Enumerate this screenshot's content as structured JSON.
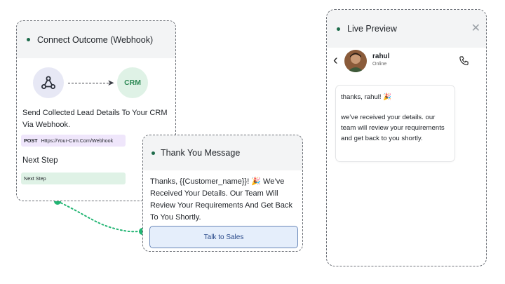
{
  "webhook_card": {
    "title": "Connect Outcome (Webhook)",
    "crm_label": "CRM",
    "description": "Send Collected Lead Details To Your CRM Via Webhook.",
    "post_method": "POST",
    "post_url": "Https://Your-Crm.Com/Webhook",
    "next_step_title": "Next Step",
    "next_step_value": "Next Step",
    "icons": {
      "webhook": "webhook-icon",
      "arrow": "arrow-right-icon"
    }
  },
  "thank_you_card": {
    "title": "Thank You Message",
    "message": "Thanks, {{Customer_name}}! 🎉 We’ve Received Your Details. Our Team Will Review Your Requirements And Get Back To You Shortly.",
    "button_label": "Talk to Sales"
  },
  "live_preview": {
    "title": "Live Preview",
    "contact_name": "rahul",
    "contact_status": "Online",
    "bubble_greeting": "thanks, rahul! 🎉",
    "bubble_body": "we’ve received your details. our team will review your requirements and get back to you shortly.",
    "icons": {
      "close": "close-icon",
      "back": "chevron-left-icon",
      "call": "phone-icon"
    }
  },
  "colors": {
    "accent_green": "#1d6b4a",
    "crm_green": "#2f8a57",
    "connector_green": "#22b573",
    "button_blue": "#e5eefb",
    "post_purple": "#efe6fb"
  }
}
